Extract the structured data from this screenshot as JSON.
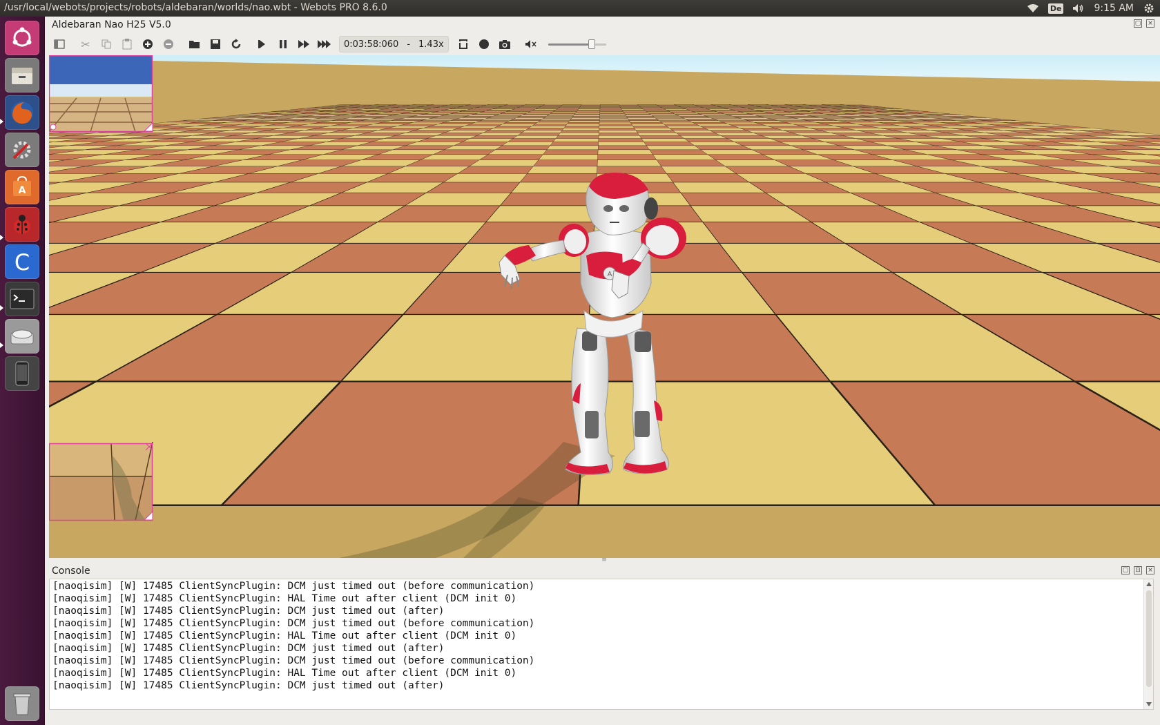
{
  "system": {
    "window_title": "/usr/local/webots/projects/robots/aldebaran/worlds/nao.wbt - Webots PRO 8.6.0",
    "keyboard_layout": "De",
    "clock": "9:15 AM",
    "icons": [
      "wifi-icon",
      "keyboard-icon",
      "volume-icon",
      "settings-gear-icon"
    ]
  },
  "launcher": {
    "items": [
      {
        "name": "ubuntu-dash-icon",
        "color": "#c43b75"
      },
      {
        "name": "files-icon",
        "color": "#7a7a7a"
      },
      {
        "name": "firefox-icon",
        "color": "#e0621d"
      },
      {
        "name": "system-settings-icon",
        "color": "#7b7b7b"
      },
      {
        "name": "software-center-icon",
        "color": "#e06a2b"
      },
      {
        "name": "webots-ladybug-icon",
        "color": "#b8272a"
      },
      {
        "name": "clion-icon",
        "color": "#2a6ad0"
      },
      {
        "name": "terminal-icon",
        "color": "#3a3a3a"
      },
      {
        "name": "disk-icon",
        "color": "#9a9a9a"
      },
      {
        "name": "phone-icon",
        "color": "#444444"
      },
      {
        "name": "trash-icon",
        "color": "#8a8a8a"
      }
    ]
  },
  "app": {
    "title": "Aldebaran Nao H25 V5.0",
    "toolbar": {
      "icons": [
        "toggle-scene-tree-icon",
        "cut-icon",
        "copy-icon",
        "paste-icon",
        "add-node-icon",
        "delete-node-icon",
        "open-world-icon",
        "save-world-icon",
        "reload-world-icon",
        "step-icon",
        "pause-icon",
        "run-icon",
        "fast-icon"
      ],
      "time": "0:03:58:060",
      "time_sep": "-",
      "speed": "1.43x",
      "record_icons": [
        "record-movie-icon",
        "record-animation-icon",
        "screenshot-icon"
      ],
      "mute_icon": "mute-icon",
      "volume_level": 0.75
    },
    "console": {
      "title": "Console",
      "lines": [
        "[naoqisim] [W] 17485 ClientSyncPlugin: DCM just timed out (before communication)",
        "[naoqisim] [W] 17485 ClientSyncPlugin: HAL Time out after client (DCM init 0)",
        "[naoqisim] [W] 17485 ClientSyncPlugin: DCM just timed out (after)",
        "[naoqisim] [W] 17485 ClientSyncPlugin: DCM just timed out (before communication)",
        "[naoqisim] [W] 17485 ClientSyncPlugin: HAL Time out after client (DCM init 0)",
        "[naoqisim] [W] 17485 ClientSyncPlugin: DCM just timed out (after)",
        "[naoqisim] [W] 17485 ClientSyncPlugin: DCM just timed out (before communication)",
        "[naoqisim] [W] 17485 ClientSyncPlugin: HAL Time out after client (DCM init 0)",
        "[naoqisim] [W] 17485 ClientSyncPlugin: DCM just timed out (after)"
      ]
    },
    "colors": {
      "robot_accent": "#d81e3c",
      "overlay_border": "#e040a0",
      "tile_light": "#e6cd7a",
      "tile_dark": "#c77a56",
      "sky": "#d7f0f7"
    }
  }
}
